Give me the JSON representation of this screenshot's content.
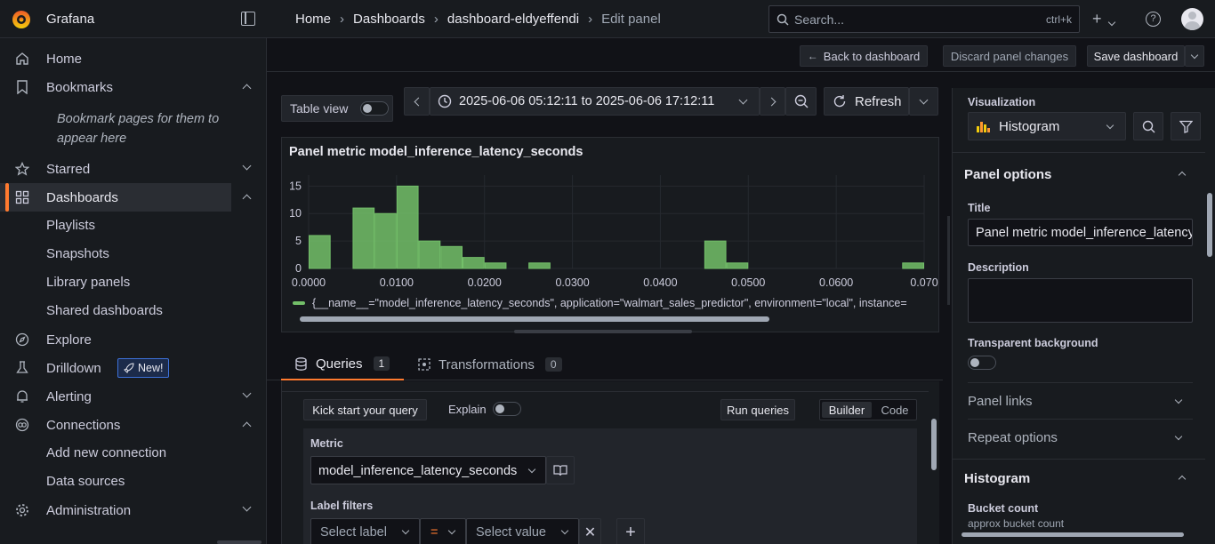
{
  "app": {
    "name": "Grafana"
  },
  "breadcrumbs": [
    "Home",
    "Dashboards",
    "dashboard-eldyeffendi",
    "Edit panel"
  ],
  "search": {
    "placeholder": "Search...",
    "shortcut": "ctrl+k"
  },
  "sidebar": {
    "items": [
      {
        "label": "Home",
        "icon": "home-icon"
      },
      {
        "label": "Bookmarks",
        "icon": "bookmark-icon"
      },
      {
        "label": "Starred",
        "icon": "star-icon"
      },
      {
        "label": "Dashboards",
        "icon": "dashboards-icon"
      },
      {
        "label": "Explore",
        "icon": "compass-icon"
      },
      {
        "label": "Drilldown",
        "icon": "drilldown-icon"
      },
      {
        "label": "Alerting",
        "icon": "bell-icon"
      },
      {
        "label": "Connections",
        "icon": "connections-icon"
      },
      {
        "label": "Administration",
        "icon": "gear-icon"
      }
    ],
    "bookmark_hint": "Bookmark pages for them to appear here",
    "dashboards_sub": [
      "Playlists",
      "Snapshots",
      "Library panels",
      "Shared dashboards"
    ],
    "drilldown_badge": "New!",
    "connections_sub": [
      "Add new connection",
      "Data sources"
    ]
  },
  "actions": {
    "back": "Back to dashboard",
    "discard": "Discard panel changes",
    "save": "Save dashboard"
  },
  "toolbar": {
    "table_view": "Table view",
    "time_range": "2025-06-06 05:12:11 to 2025-06-06 17:12:11",
    "refresh": "Refresh"
  },
  "panel": {
    "title": "Panel metric model_inference_latency_seconds",
    "legend": "{__name__=\"model_inference_latency_seconds\", application=\"walmart_sales_predictor\", environment=\"local\", instance="
  },
  "chart_data": {
    "type": "bar",
    "title": "Panel metric model_inference_latency_seconds",
    "xlabel": "",
    "ylabel": "",
    "xlim": [
      0,
      0.07
    ],
    "ylim": [
      0,
      17
    ],
    "x_ticks": [
      "0.0000",
      "0.0100",
      "0.0200",
      "0.0300",
      "0.0400",
      "0.0500",
      "0.0600",
      "0.070"
    ],
    "y_ticks": [
      "0",
      "5",
      "10",
      "15"
    ],
    "bins": [
      {
        "start": 0.0,
        "end": 0.0025,
        "value": 6
      },
      {
        "start": 0.005,
        "end": 0.0075,
        "value": 11
      },
      {
        "start": 0.0075,
        "end": 0.01,
        "value": 10
      },
      {
        "start": 0.01,
        "end": 0.0125,
        "value": 15
      },
      {
        "start": 0.0125,
        "end": 0.015,
        "value": 5
      },
      {
        "start": 0.015,
        "end": 0.0175,
        "value": 4
      },
      {
        "start": 0.0175,
        "end": 0.02,
        "value": 2
      },
      {
        "start": 0.02,
        "end": 0.0225,
        "value": 1
      },
      {
        "start": 0.025,
        "end": 0.0275,
        "value": 1
      },
      {
        "start": 0.045,
        "end": 0.0475,
        "value": 5
      },
      {
        "start": 0.0475,
        "end": 0.05,
        "value": 1
      },
      {
        "start": 0.0675,
        "end": 0.07,
        "value": 1
      }
    ],
    "color": "#73bf69"
  },
  "tabs": [
    {
      "label": "Queries",
      "count": "1"
    },
    {
      "label": "Transformations",
      "count": "0"
    }
  ],
  "query": {
    "kick_start": "Kick start your query",
    "explain": "Explain",
    "run": "Run queries",
    "builder": "Builder",
    "code": "Code",
    "metric_label": "Metric",
    "metric_value": "model_inference_latency_seconds",
    "label_filters": "Label filters",
    "select_label": "Select label",
    "operator": "=",
    "select_value": "Select value"
  },
  "options": {
    "visualization_label": "Visualization",
    "visualization_value": "Histogram",
    "panel_options": "Panel options",
    "title_label": "Title",
    "title_value": "Panel metric model_inference_latency_seconds",
    "description_label": "Description",
    "transparent_label": "Transparent background",
    "panel_links": "Panel links",
    "repeat_options": "Repeat options",
    "histogram": "Histogram",
    "bucket_count": "Bucket count",
    "bucket_count_hint": "approx bucket count"
  },
  "colors": {
    "accent": "#ff7a2f",
    "series": "#73bf69",
    "link": "#6e9fff"
  }
}
